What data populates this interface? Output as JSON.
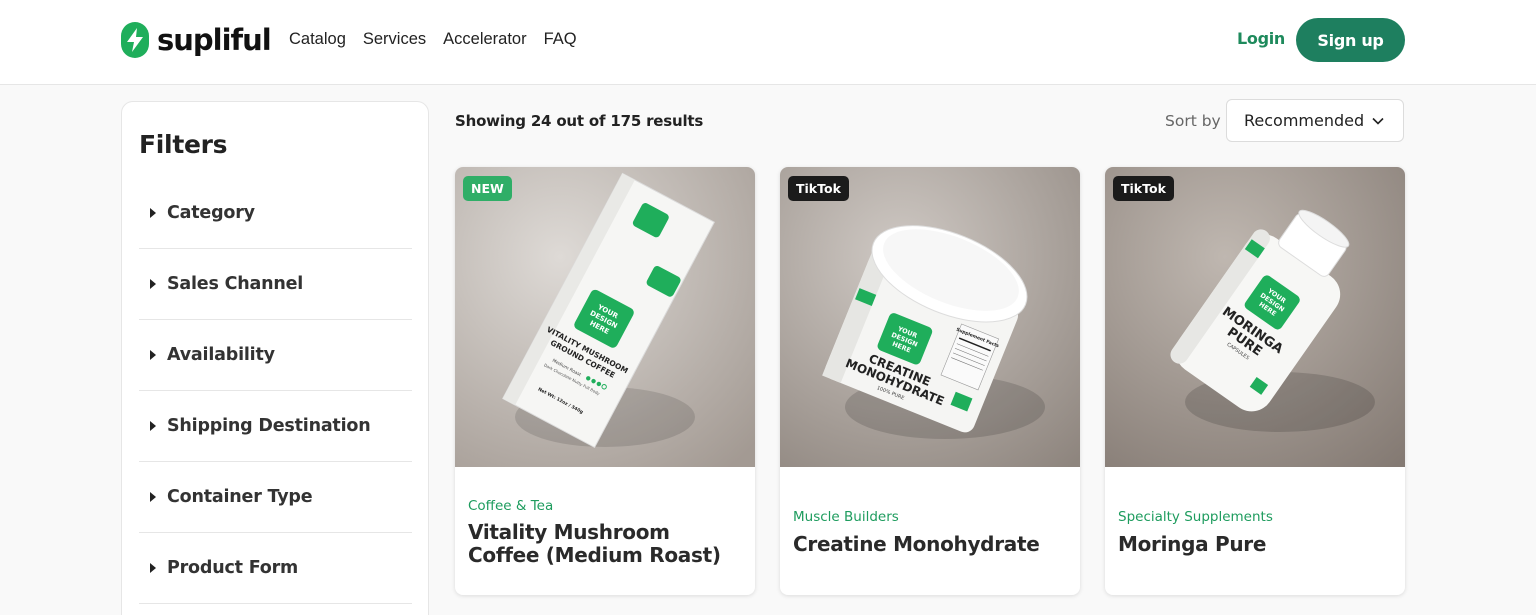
{
  "header": {
    "logo_text": "supliful",
    "nav": [
      "Catalog",
      "Services",
      "Accelerator",
      "FAQ"
    ],
    "login_label": "Login",
    "signup_label": "Sign up",
    "brand_color": "#1e7f5f",
    "logo_color": "#1fae5b"
  },
  "filters": {
    "title": "Filters",
    "items": [
      "Category",
      "Sales Channel",
      "Availability",
      "Shipping Destination",
      "Container Type",
      "Product Form"
    ]
  },
  "results": {
    "summary": "Showing 24 out of 175 results",
    "sort_label": "Sort by",
    "sort_value": "Recommended"
  },
  "products": [
    {
      "badge": "NEW",
      "category": "Coffee & Tea",
      "name": "Vitality Mushroom Coffee (Medium Roast)",
      "package_text": [
        "YOUR",
        "DESIGN",
        "HERE",
        "VITALITY MUSHROOM",
        "GROUND COFFEE",
        "Medium Roast",
        "Dark Chocolate Nutty Full Body",
        "Net Wt: 12oz / 340g"
      ]
    },
    {
      "badge": "TikTok",
      "category": "Muscle Builders",
      "name": "Creatine Monohydrate",
      "package_text": [
        "YOUR",
        "DESIGN",
        "HERE",
        "CREATINE",
        "MONOHYDRATE",
        "100% PURE",
        "Supplement Facts"
      ]
    },
    {
      "badge": "TikTok",
      "category": "Specialty Supplements",
      "name": "Moringa Pure",
      "package_text": [
        "YOUR",
        "DESIGN",
        "HERE",
        "MORINGA",
        "PURE",
        "CAPSULES"
      ]
    }
  ]
}
